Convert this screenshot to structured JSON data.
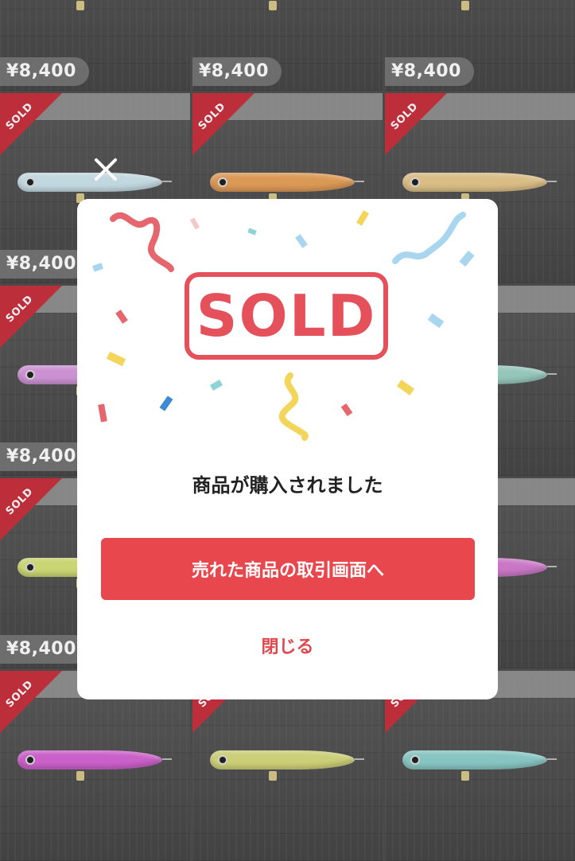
{
  "background_grid": {
    "items": [
      {
        "price": "¥8,400",
        "sold": false,
        "lure_color": "#d8d8d8"
      },
      {
        "price": "¥8,400",
        "sold": false,
        "lure_color": "#d8d8d8"
      },
      {
        "price": "¥8,400",
        "sold": false,
        "lure_color": "#d8d8d8"
      },
      {
        "price": "¥8,400",
        "sold": true,
        "lure_color": "#cfe6ee"
      },
      {
        "price": "",
        "sold": true,
        "lure_color": "#e9a35c"
      },
      {
        "price": "",
        "sold": true,
        "lure_color": "#e7c98e"
      },
      {
        "price": "¥8,400",
        "sold": true,
        "lure_color": "#d99be0"
      },
      {
        "price": "",
        "sold": false,
        "lure_color": "#b7b7b7"
      },
      {
        "price": "",
        "sold": false,
        "lure_color": "#9fd3c7"
      },
      {
        "price": "¥8,400",
        "sold": true,
        "lure_color": "#d6e27b"
      },
      {
        "price": "",
        "sold": false,
        "lure_color": "#b7b7b7"
      },
      {
        "price": "",
        "sold": false,
        "lure_color": "#d77fd3"
      },
      {
        "price": "",
        "sold": true,
        "lure_color": "#d766d6"
      },
      {
        "price": "",
        "sold": true,
        "lure_color": "#d9dc7f"
      },
      {
        "price": "",
        "sold": true,
        "lure_color": "#90d2cf"
      }
    ],
    "sold_ribbon_label": "SOLD"
  },
  "modal": {
    "stamp_text": "SOLD",
    "message": "商品が購入されました",
    "primary_button_label": "売れた商品の取引画面へ",
    "close_label": "閉じる",
    "colors": {
      "accent": "#e8484d",
      "confetti": [
        "#e5676d",
        "#a9d6ef",
        "#f2d55a",
        "#8fd3d6",
        "#e5676d"
      ]
    }
  },
  "icons": {
    "close": "close-icon"
  }
}
